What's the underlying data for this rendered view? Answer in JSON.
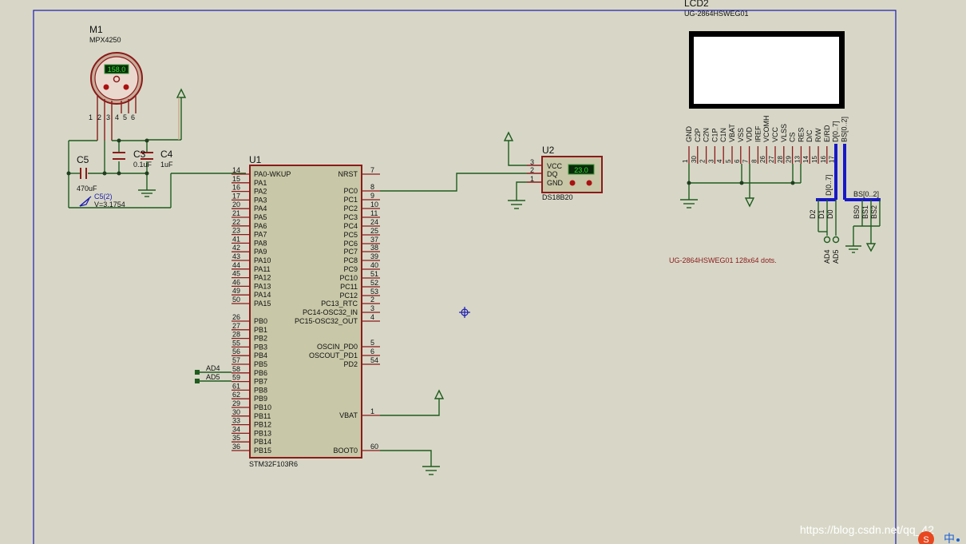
{
  "m1": {
    "ref": "M1",
    "part": "MPX4250",
    "display": "158.0",
    "pins": [
      "1",
      "2",
      "3",
      "4",
      "5",
      "6"
    ]
  },
  "c5": {
    "ref": "C5",
    "value": "470uF"
  },
  "c3": {
    "ref": "C3",
    "value": "0.1uF"
  },
  "c4": {
    "ref": "C4",
    "value": "1uF"
  },
  "probe": {
    "name": "C5(2)",
    "value": "V=3.1754"
  },
  "u1": {
    "ref": "U1",
    "part": "STM32F103R6",
    "left_pins": [
      {
        "num": "14",
        "name": "PA0-WKUP"
      },
      {
        "num": "15",
        "name": "PA1"
      },
      {
        "num": "16",
        "name": "PA2"
      },
      {
        "num": "17",
        "name": "PA3"
      },
      {
        "num": "20",
        "name": "PA4"
      },
      {
        "num": "21",
        "name": "PA5"
      },
      {
        "num": "22",
        "name": "PA6"
      },
      {
        "num": "23",
        "name": "PA7"
      },
      {
        "num": "41",
        "name": "PA8"
      },
      {
        "num": "42",
        "name": "PA9"
      },
      {
        "num": "43",
        "name": "PA10"
      },
      {
        "num": "44",
        "name": "PA11"
      },
      {
        "num": "45",
        "name": "PA12"
      },
      {
        "num": "46",
        "name": "PA13"
      },
      {
        "num": "49",
        "name": "PA14"
      },
      {
        "num": "50",
        "name": "PA15"
      },
      {
        "num": "26",
        "name": "PB0"
      },
      {
        "num": "27",
        "name": "PB1"
      },
      {
        "num": "28",
        "name": "PB2"
      },
      {
        "num": "55",
        "name": "PB3"
      },
      {
        "num": "56",
        "name": "PB4"
      },
      {
        "num": "57",
        "name": "PB5"
      },
      {
        "num": "58",
        "name": "PB6"
      },
      {
        "num": "59",
        "name": "PB7"
      },
      {
        "num": "61",
        "name": "PB8"
      },
      {
        "num": "62",
        "name": "PB9"
      },
      {
        "num": "29",
        "name": "PB10"
      },
      {
        "num": "30",
        "name": "PB11"
      },
      {
        "num": "33",
        "name": "PB12"
      },
      {
        "num": "34",
        "name": "PB13"
      },
      {
        "num": "35",
        "name": "PB14"
      },
      {
        "num": "36",
        "name": "PB15"
      }
    ],
    "right_pins": [
      {
        "num": "7",
        "name": "NRST"
      },
      {
        "num": "8",
        "name": "PC0"
      },
      {
        "num": "9",
        "name": "PC1"
      },
      {
        "num": "10",
        "name": "PC2"
      },
      {
        "num": "11",
        "name": "PC3"
      },
      {
        "num": "24",
        "name": "PC4"
      },
      {
        "num": "25",
        "name": "PC5"
      },
      {
        "num": "37",
        "name": "PC6"
      },
      {
        "num": "38",
        "name": "PC7"
      },
      {
        "num": "39",
        "name": "PC8"
      },
      {
        "num": "40",
        "name": "PC9"
      },
      {
        "num": "51",
        "name": "PC10"
      },
      {
        "num": "52",
        "name": "PC11"
      },
      {
        "num": "53",
        "name": "PC12"
      },
      {
        "num": "2",
        "name": "PC13_RTC"
      },
      {
        "num": "3",
        "name": "PC14-OSC32_IN"
      },
      {
        "num": "4",
        "name": "PC15-OSC32_OUT"
      },
      {
        "num": "5",
        "name": "OSCIN_PD0"
      },
      {
        "num": "6",
        "name": "OSCOUT_PD1"
      },
      {
        "num": "54",
        "name": "PD2"
      },
      {
        "num": "1",
        "name": "VBAT"
      },
      {
        "num": "60",
        "name": "BOOT0"
      }
    ],
    "net_labels": [
      "AD4",
      "AD5"
    ]
  },
  "u2": {
    "ref": "U2",
    "part": "DS18B20",
    "display": "23.0",
    "pins": [
      {
        "num": "3",
        "name": "VCC"
      },
      {
        "num": "2",
        "name": "DQ"
      },
      {
        "num": "1",
        "name": "GND"
      }
    ]
  },
  "lcd": {
    "ref": "LCD2",
    "part": "UG-2864HSWEG01",
    "pins": [
      {
        "num": "1",
        "name": "GND"
      },
      {
        "num": "30",
        "name": "C2P"
      },
      {
        "num": "2",
        "name": "C2N"
      },
      {
        "num": "3",
        "name": "C1P"
      },
      {
        "num": "4",
        "name": "C1N"
      },
      {
        "num": "5",
        "name": "VBAT"
      },
      {
        "num": "6",
        "name": "VSS"
      },
      {
        "num": "7",
        "name": "VDD"
      },
      {
        "num": "8",
        "name": "IREF"
      },
      {
        "num": "26",
        "name": "VCOMH"
      },
      {
        "num": "27",
        "name": "VCC"
      },
      {
        "num": "28",
        "name": "VLSS"
      },
      {
        "num": "29",
        "name": "CS"
      },
      {
        "num": "13",
        "name": "RES"
      },
      {
        "num": "14",
        "name": "D/C"
      },
      {
        "num": "15",
        "name": "R/W"
      },
      {
        "num": "16",
        "name": "E/RD"
      },
      {
        "num": "17",
        "name": "D[0..7]"
      },
      {
        "num": "",
        "name": "BS[0..2]"
      }
    ],
    "bus_d": "D[0..7]",
    "bus_bs": "BS[0..2]",
    "d_taps": [
      "D2",
      "D1",
      "D0"
    ],
    "bs_taps": [
      "BS0",
      "BS1",
      "BS2"
    ],
    "net_labels": [
      "AD4",
      "AD5"
    ],
    "description": "UG-2864HSWEG01 128x64 dots."
  },
  "watermark": "https://blog.csdn.net/qq_42"
}
